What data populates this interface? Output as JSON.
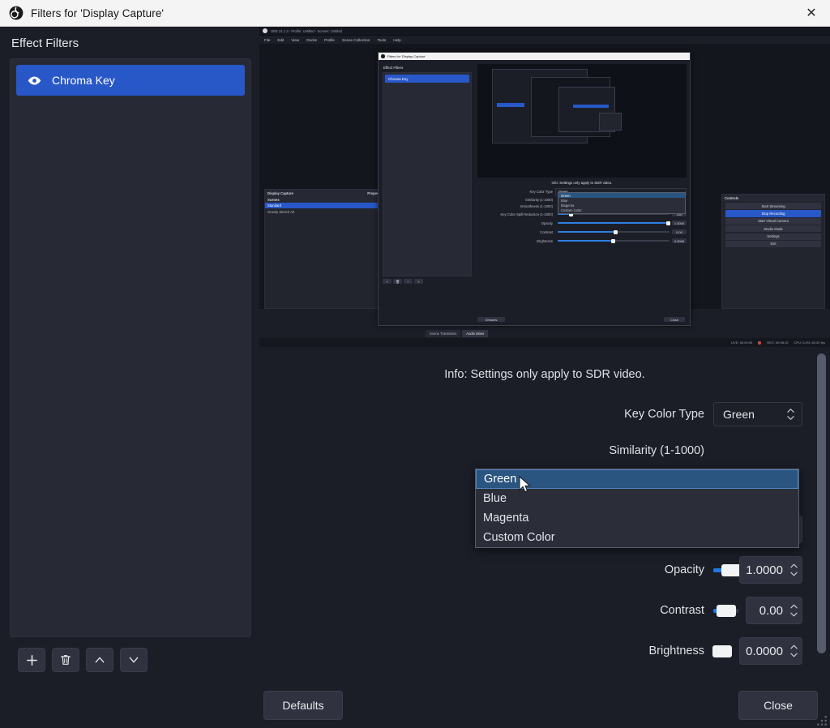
{
  "window": {
    "title": "Filters for 'Display Capture'",
    "close_label": "✕",
    "app_icon": "obs-logo-icon"
  },
  "left_panel": {
    "heading": "Effect Filters",
    "filters": [
      {
        "name": "Chroma Key",
        "visible": true,
        "selected": true
      }
    ],
    "tools": [
      {
        "name": "add-filter-button",
        "icon": "plus-icon",
        "label": "+"
      },
      {
        "name": "remove-filter-button",
        "icon": "trash-icon",
        "label": ""
      },
      {
        "name": "move-filter-up-button",
        "icon": "chevron-up-icon",
        "label": ""
      },
      {
        "name": "move-filter-down-button",
        "icon": "chevron-down-icon",
        "label": ""
      }
    ]
  },
  "preview": {
    "title": "OBS 31.1.3 - Profile: Untitled - Scenes: Untitled",
    "menu": [
      "File",
      "Edit",
      "View",
      "Docks",
      "Profile",
      "Scene Collection",
      "Tools",
      "Help"
    ],
    "source_dock": {
      "title": "Display Capture",
      "properties_label": "Properties"
    },
    "scenes_dock": {
      "title": "Scenes",
      "items": [
        "Standard",
        "Gravity Sketch Alt"
      ],
      "selected": "Standard"
    },
    "controls_dock": {
      "title": "Controls",
      "buttons": [
        "Start Streaming",
        "Stop Recording",
        "Start Virtual Camera",
        "Studio Mode",
        "Settings",
        "Exit"
      ],
      "active": "Stop Recording"
    },
    "tabs": [
      "Scene Transitions",
      "Audio Mixer"
    ],
    "active_tab": "Audio Mixer",
    "status": {
      "live": "LIVE: 00:00:00",
      "rec": "REC: 00:08:15",
      "cpu": "CPU: 0.4%, 60.00 fps"
    },
    "nested_dialog": {
      "title": "Filters for 'Display Capture'",
      "effect_filters_label": "Effect Filters",
      "filter_name": "Chroma Key",
      "info": "Info: Settings only apply to SDR video.",
      "defaults_label": "Defaults",
      "close_label": "Close",
      "rows": [
        {
          "label": "Key Color Type",
          "value": "Green"
        },
        {
          "label": "Similarity (1-1000)",
          "value": ""
        },
        {
          "label": "Smoothness (1-1000)",
          "value": ""
        },
        {
          "label": "Key Color Spill Reduction (1-1000)",
          "value": "100",
          "pct": 10
        },
        {
          "label": "Opacity",
          "value": "1.0000",
          "pct": 97
        },
        {
          "label": "Contrast",
          "value": "0.00",
          "pct": 50
        },
        {
          "label": "Brightness",
          "value": "0.0000",
          "pct": 48
        }
      ],
      "dropdown_options": [
        "Green",
        "Blue",
        "Magenta",
        "Custom Color"
      ]
    }
  },
  "settings": {
    "info": "Info: Settings only apply to SDR video.",
    "key_color_type": {
      "label": "Key Color Type",
      "value": "Green",
      "options": [
        "Green",
        "Blue",
        "Magenta",
        "Custom Color"
      ],
      "highlighted": "Green",
      "open": true
    },
    "hidden_rows": [
      {
        "label": "Similarity (1-1000)"
      },
      {
        "label": "Smoothness (1-1000)"
      }
    ],
    "sliders": [
      {
        "label": "Key Color Spill Reduction (1-1000)",
        "value": "100",
        "percent": 10
      },
      {
        "label": "Opacity",
        "value": "1.0000",
        "percent": 97
      },
      {
        "label": "Contrast",
        "value": "0.00",
        "percent": 50
      },
      {
        "label": "Brightness",
        "value": "0.0000",
        "percent": 48
      }
    ]
  },
  "footer": {
    "defaults_label": "Defaults",
    "close_label": "Close"
  },
  "colors": {
    "accent_blue": "#2857c8",
    "slider_blue": "#1f7ae0",
    "dropdown_highlight": "#2a5580",
    "panel_bg": "#1b1d27",
    "list_bg": "#272a35",
    "titlebar_bg": "#f4f4f4"
  }
}
